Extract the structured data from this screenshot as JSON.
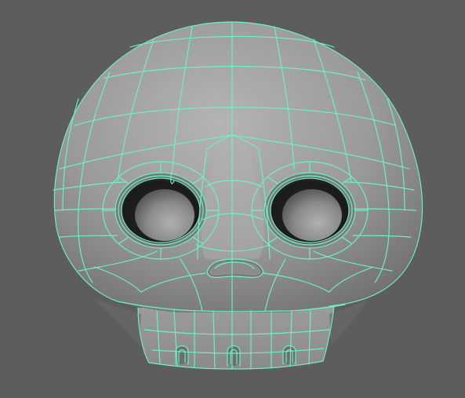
{
  "viewport": {
    "background_color": "#5d5d5d",
    "wireframe_color": "#6ef2c0",
    "mesh_color": "#9a9a9a"
  },
  "model": {
    "icon": "skull-mesh-icon"
  }
}
